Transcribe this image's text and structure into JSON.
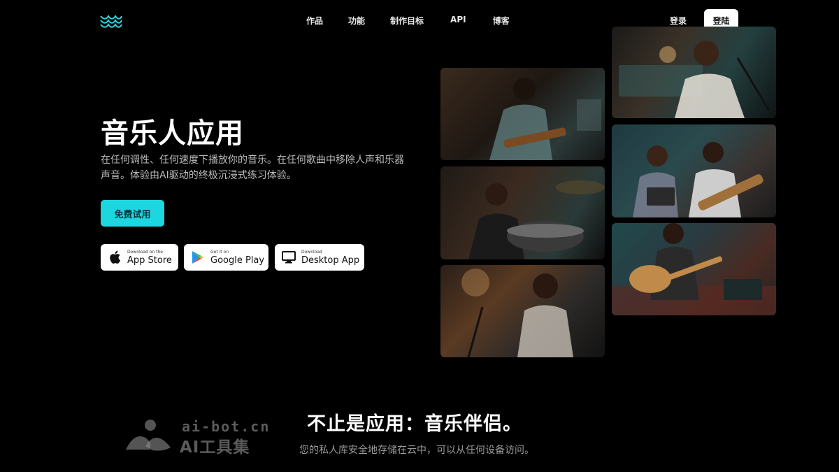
{
  "nav": {
    "links": [
      "作品",
      "功能",
      "制作目标",
      "API",
      "博客"
    ],
    "login": "登录",
    "signup": "登陆"
  },
  "hero": {
    "title": "音乐人应用",
    "description": "在任何调性、任何速度下播放你的音乐。在任何歌曲中移除人声和乐器声音。体验由AI驱动的终极沉浸式练习体验。",
    "cta": "免费试用"
  },
  "stores": [
    {
      "small": "Download on the",
      "big": "App Store",
      "icon": "apple-icon"
    },
    {
      "small": "Get it on",
      "big": "Google Play",
      "icon": "google-play-icon"
    },
    {
      "small": "Download",
      "big": "Desktop App",
      "icon": "desktop-icon"
    }
  ],
  "section": {
    "title": "不止是应用：音乐伴侣。",
    "description": "您的私人库安全地存储在云中，可以从任何设备访问。"
  },
  "watermark": {
    "domain": "ai-bot.cn",
    "name": "AI工具集"
  },
  "colors": {
    "accent": "#1cd6e0",
    "background": "#000000"
  }
}
